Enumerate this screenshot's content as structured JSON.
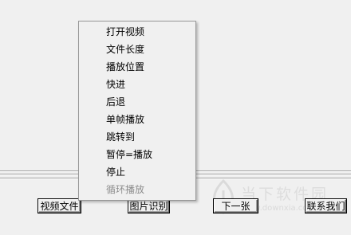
{
  "menu": {
    "items": [
      {
        "label": "打开视频"
      },
      {
        "label": "文件长度"
      },
      {
        "label": "播放位置"
      },
      {
        "label": "快进"
      },
      {
        "label": "后退"
      },
      {
        "label": "单帧播放"
      },
      {
        "label": "跳转到"
      },
      {
        "label": "暂停=播放"
      },
      {
        "label": "停止"
      },
      {
        "label": "循环播放",
        "disabled": true
      }
    ]
  },
  "buttons": {
    "video_file": "视频文件",
    "image_recognition": "图片识别",
    "next": "下一张",
    "contact_us": "联系我们"
  },
  "watermark": {
    "brand": "当下软件园",
    "url": "www.downxia.com",
    "logo_icon": "downxia-logo-icon"
  },
  "colors": {
    "window_bg": "#f0f0f0",
    "menu_border": "#979797",
    "disabled_text": "#8d8d8d"
  }
}
